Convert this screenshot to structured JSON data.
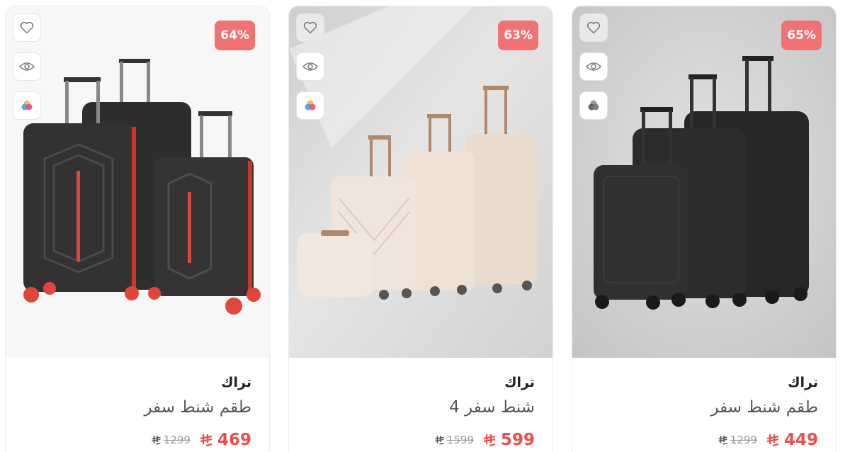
{
  "products": [
    {
      "discount": "64%",
      "brand": "تراك",
      "title": "طقم شنط سفر",
      "price": "469",
      "old_price": "1299",
      "currency_icon": "riyal-symbol-icon"
    },
    {
      "discount": "63%",
      "brand": "تراك",
      "title": "شنط سفر 4",
      "price": "599",
      "old_price": "1599",
      "currency_icon": "riyal-symbol-icon"
    },
    {
      "discount": "65%",
      "brand": "تراك",
      "title": "طقم شنط سفر",
      "price": "449",
      "old_price": "1299",
      "currency_icon": "riyal-symbol-icon"
    }
  ],
  "colors": {
    "discount_badge": "#f07272",
    "price": "#ee4d4d",
    "old_price": "#9a9a9a"
  }
}
